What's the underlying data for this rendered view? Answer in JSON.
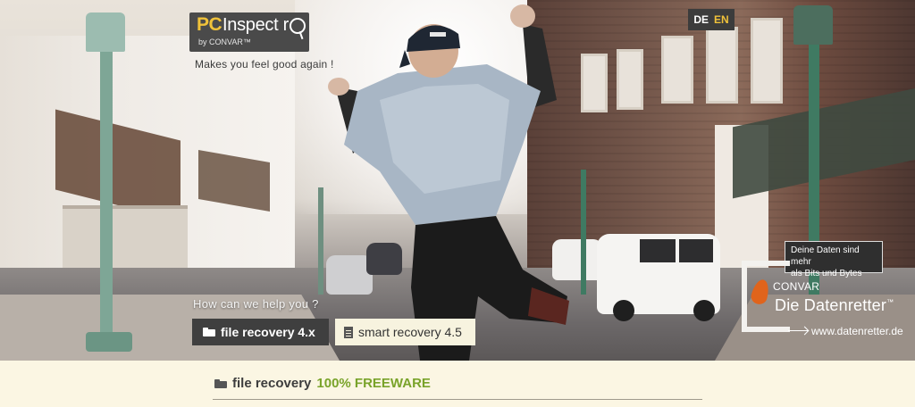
{
  "brand": {
    "logo_pc": "PC",
    "logo_inspector": "Inspect r",
    "logo_by": "by CONVAR™",
    "tagline": "Makes you feel good again !"
  },
  "language": {
    "de": "DE",
    "en": "EN"
  },
  "hero": {
    "help_text": "How can we help you ?",
    "buttons": [
      {
        "label": "file recovery 4.x",
        "icon": "folder-open-icon",
        "active": true
      },
      {
        "label": "smart recovery 4.5",
        "icon": "file-icon",
        "active": false
      }
    ]
  },
  "convar_badge": {
    "bubble_line1": "Deine Daten sind mehr",
    "bubble_line2": "als Bits und Bytes",
    "convar": "CONVAR",
    "title": "Die Datenretter",
    "tm": "™",
    "url": "www.datenretter.de"
  },
  "section": {
    "title": "file recovery",
    "freeware": "100% FREEWARE"
  },
  "colors": {
    "accent_yellow": "#f0c23a",
    "freeware_green": "#79a32a",
    "dark_button": "#3f3f3f",
    "cream": "#fbf6e3"
  }
}
